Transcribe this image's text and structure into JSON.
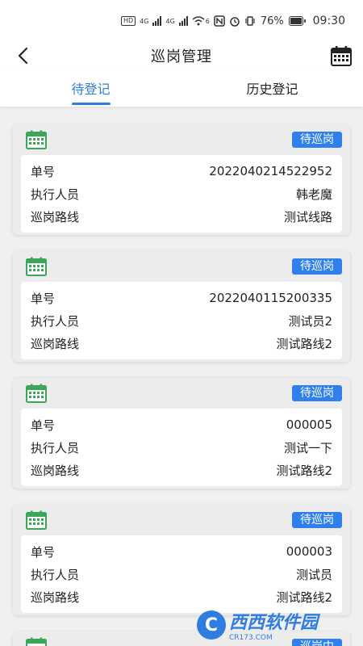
{
  "status_bar": {
    "chips": [
      "HD"
    ],
    "signal_labels": [
      "4G",
      "4G"
    ],
    "wifi_label": "6",
    "battery_percent": "76%",
    "battery_level": 0.76,
    "time": "09:30"
  },
  "header": {
    "title": "巡岗管理"
  },
  "tabs": [
    {
      "label": "待登记",
      "active": true
    },
    {
      "label": "历史登记",
      "active": false
    }
  ],
  "records": [
    {
      "status": "待巡岗",
      "number_label": "单号",
      "number": "2022040214522952",
      "executor_label": "执行人员",
      "executor": "韩老魔",
      "route_label": "巡岗路线",
      "route": "测试线路"
    },
    {
      "status": "待巡岗",
      "number_label": "单号",
      "number": "2022040115200335",
      "executor_label": "执行人员",
      "executor": "测试员2",
      "route_label": "巡岗路线",
      "route": "测试路线2"
    },
    {
      "status": "待巡岗",
      "number_label": "单号",
      "number": "000005",
      "executor_label": "执行人员",
      "executor": "测试一下",
      "route_label": "巡岗路线",
      "route": "测试路线2"
    },
    {
      "status": "待巡岗",
      "number_label": "单号",
      "number": "000003",
      "executor_label": "执行人员",
      "executor": "测试员",
      "route_label": "巡岗路线",
      "route": "测试路线2"
    },
    {
      "status": "巡岗中"
    }
  ],
  "watermark": {
    "title": "西西软件园",
    "sub": "CR173.COM"
  },
  "colors": {
    "accent": "#2f7de1",
    "badge": "#2f80ed",
    "calendar_green": "#3aa657"
  }
}
